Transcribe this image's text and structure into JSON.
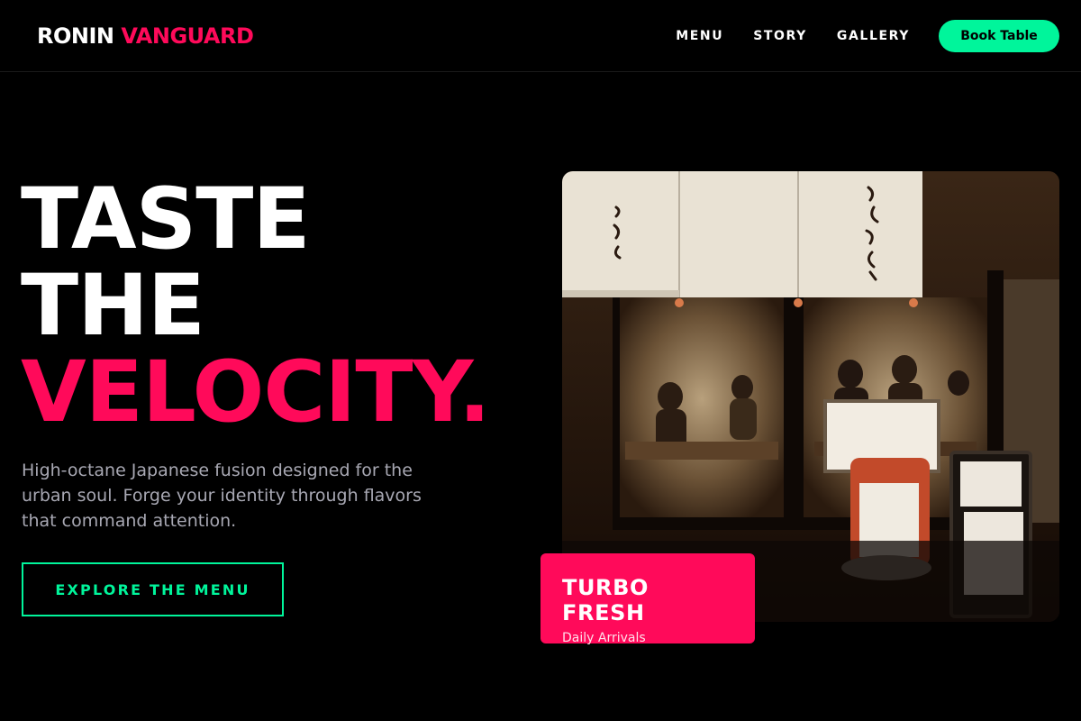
{
  "brand": {
    "part1": "RONIN",
    "part2": "VANGUARD"
  },
  "nav": {
    "links": [
      "MENU",
      "STORY",
      "GALLERY"
    ],
    "cta_label": "Book Table"
  },
  "hero": {
    "headline": [
      "TASTE",
      "THE",
      "VELOCITY."
    ],
    "description": "High-octane Japanese fusion designed for the urban soul. Forge your identity through flavors that command attention.",
    "button_label": "EXPLORE THE MENU"
  },
  "image": {
    "icon": "restaurant-storefront-photo",
    "badge_title": "TURBO FRESH",
    "badge_subtitle": "Daily Arrivals"
  },
  "colors": {
    "background": "#000000",
    "accent_pink": "#ff0a5a",
    "accent_green": "#00f59b",
    "muted_text": "#a8a8b3"
  }
}
